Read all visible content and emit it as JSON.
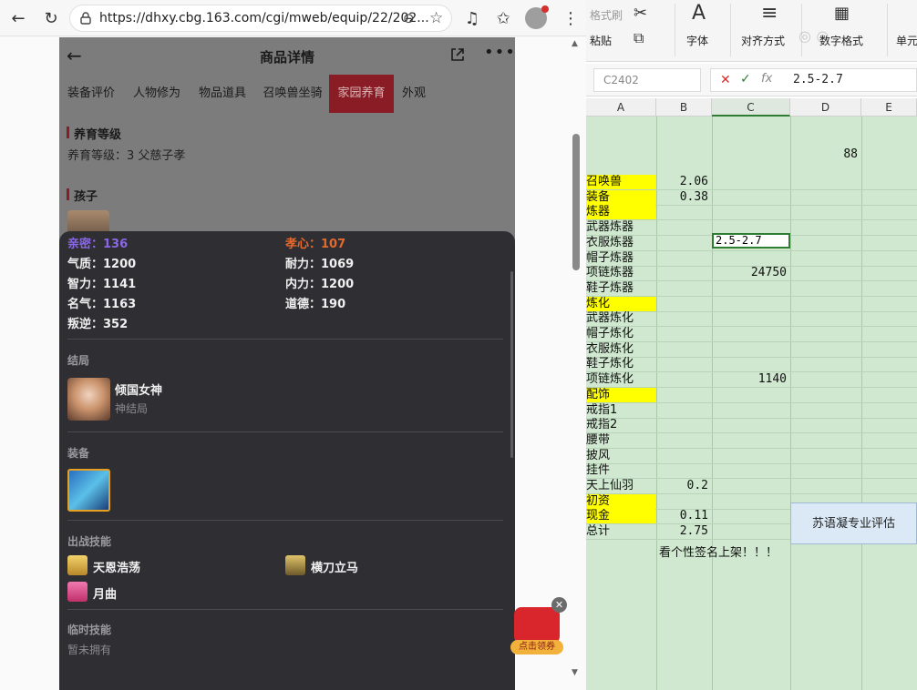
{
  "browser": {
    "url": "https://dhxy.cbg.163.com/cgi/mweb/equip/22/202..."
  },
  "mobile": {
    "header_title": "商品详情",
    "tabs": [
      "装备评价",
      "人物修为",
      "物品道具",
      "召唤兽坐骑",
      "家园养育",
      "外观"
    ],
    "active_tab_index": 4,
    "section_breed_title": "养育等级",
    "section_breed_text": "养育等级：3  父慈子孝",
    "section_child_title": "孩子",
    "popup": {
      "stats_left": [
        "亲密：136",
        "气质：1200",
        "智力：1141",
        "名气：1163",
        "叛逆：352"
      ],
      "stats_right": [
        "孝心：107",
        "耐力：1069",
        "内力：1200",
        "道德：190"
      ],
      "ending_label": "结局",
      "ending_name": "倾国女神",
      "ending_sub": "神结局",
      "equip_label": "装备",
      "battle_skills_label": "出战技能",
      "battle_skills": [
        "天恩浩荡",
        "横刀立马",
        "月曲"
      ],
      "temp_skills_label": "临时技能",
      "temp_skills_text": "暂未拥有"
    },
    "red_packet_label": "点击领券"
  },
  "spreadsheet": {
    "ribbon": {
      "format_painter": "格式刷",
      "paste": "粘贴",
      "font": "字体",
      "align": "对齐方式",
      "number_format": "数字格式",
      "cell": "单元"
    },
    "name_box": "C2402",
    "formula_value": "2.5-2.7",
    "columns": [
      "A",
      "B",
      "C",
      "D",
      "E"
    ],
    "d_value": "88",
    "a_labels": [
      "召唤兽",
      "装备",
      "炼器",
      "武器炼器",
      "衣服炼器",
      "帽子炼器",
      "项链炼器",
      "鞋子炼器",
      "炼化",
      "武器炼化",
      "帽子炼化",
      "衣服炼化",
      "鞋子炼化",
      "项链炼化",
      "配饰",
      "戒指1",
      "戒指2",
      "腰带",
      "披风",
      "挂件",
      "天上仙羽",
      "初资",
      "现金",
      "总计"
    ],
    "b_values": {
      "row0": "2.06",
      "row1": "0.38",
      "row20": "0.2",
      "row22": "0.11",
      "row23": "2.75"
    },
    "c_values": {
      "row4": "2.5-2.7",
      "row6": "24750",
      "row13": "1140"
    },
    "eval_box": "苏语凝专业评估",
    "footer_note": "看个性签名上架！！！"
  },
  "colors": {
    "active_tab": "#8a1c26",
    "popup_bg": "#2f2f33",
    "sheet_green": "#cfe8cf",
    "highlight_yellow": "#ffff00"
  }
}
